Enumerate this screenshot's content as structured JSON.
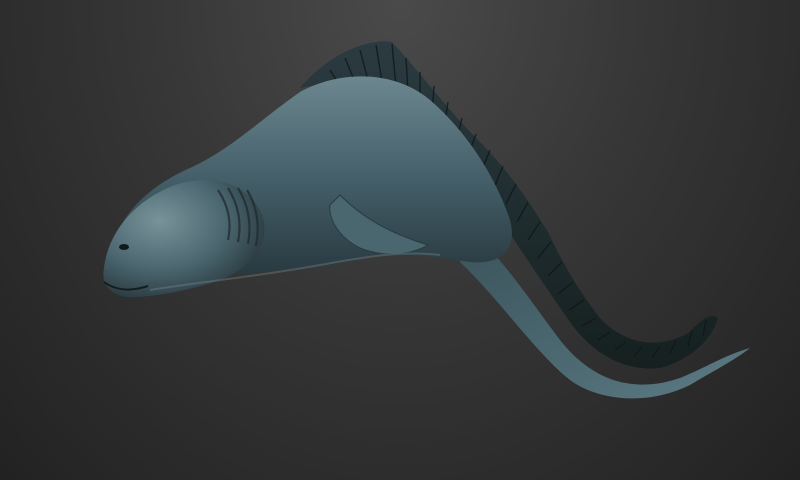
{
  "scene": {
    "subject_icon": "sea-creature-icon",
    "colors": {
      "background_light": "#4a4a4a",
      "background_dark": "#222222",
      "body_light": "#5f7880",
      "body_mid": "#3f565d",
      "body_dark": "#1e2a2e",
      "fin_dark": "#1a2327",
      "belly_highlight": "#7a9299"
    }
  }
}
